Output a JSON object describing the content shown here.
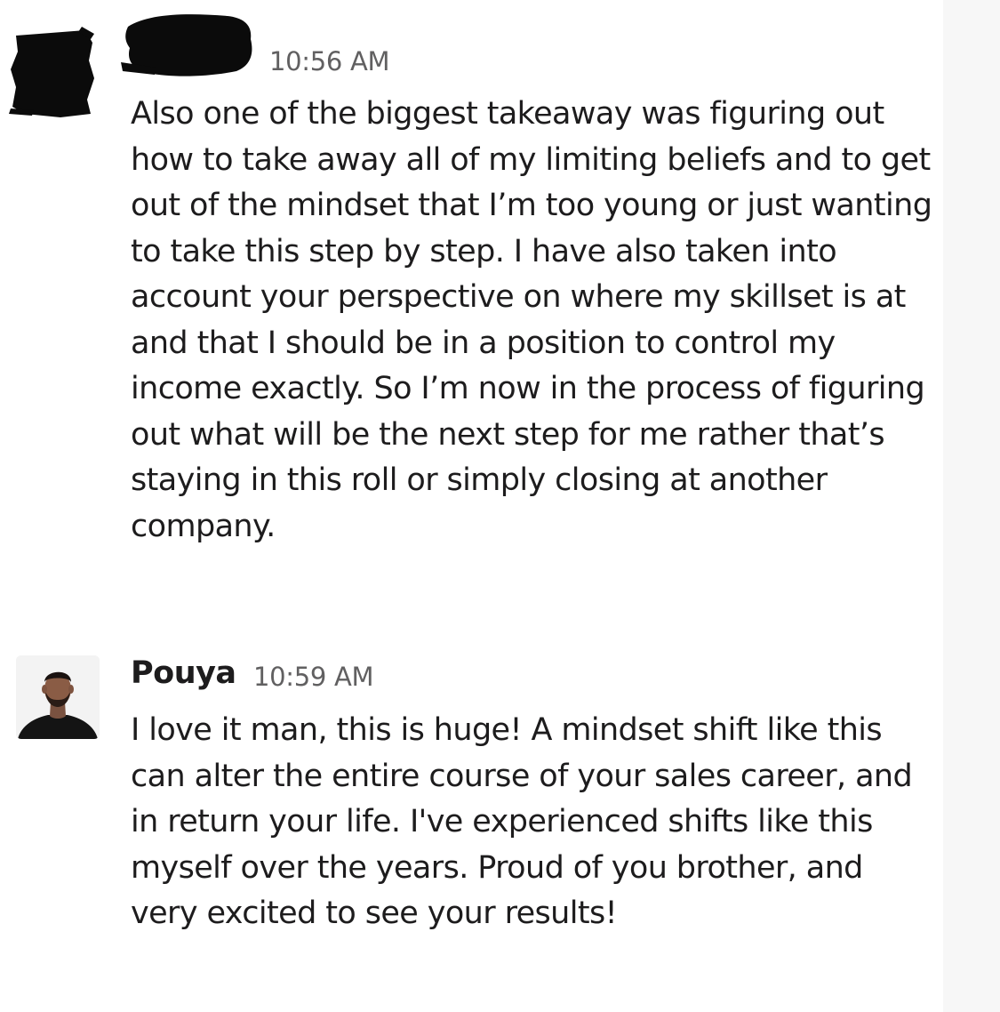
{
  "messages": [
    {
      "author": "",
      "author_redacted": true,
      "timestamp": "10:56 AM",
      "text": "Also one of the biggest takeaway was figuring out how to take away all of my limiting beliefs and to get out of the mindset that I’m too young or just wanting to take this step by step. I have also taken into account your perspective on where my skillset is at and that I should be in a position to control my income exactly. So I’m now in the process of figuring out what will be the next step for me rather that’s staying in this roll or simply closing at another company."
    },
    {
      "author": "Pouya",
      "timestamp": "10:59 AM",
      "text": "I love it man, this is huge! A mindset shift like this can alter the entire course of your sales career, and in return your life. I've experienced shifts like this myself over the years. Proud of you brother, and very excited to see your results!"
    }
  ],
  "icons": {
    "redacted_avatar": "scribble-redaction",
    "pouya_avatar": "profile-photo"
  },
  "colors": {
    "text": "#1d1c1d",
    "timestamp": "#616061",
    "background": "#ffffff"
  }
}
